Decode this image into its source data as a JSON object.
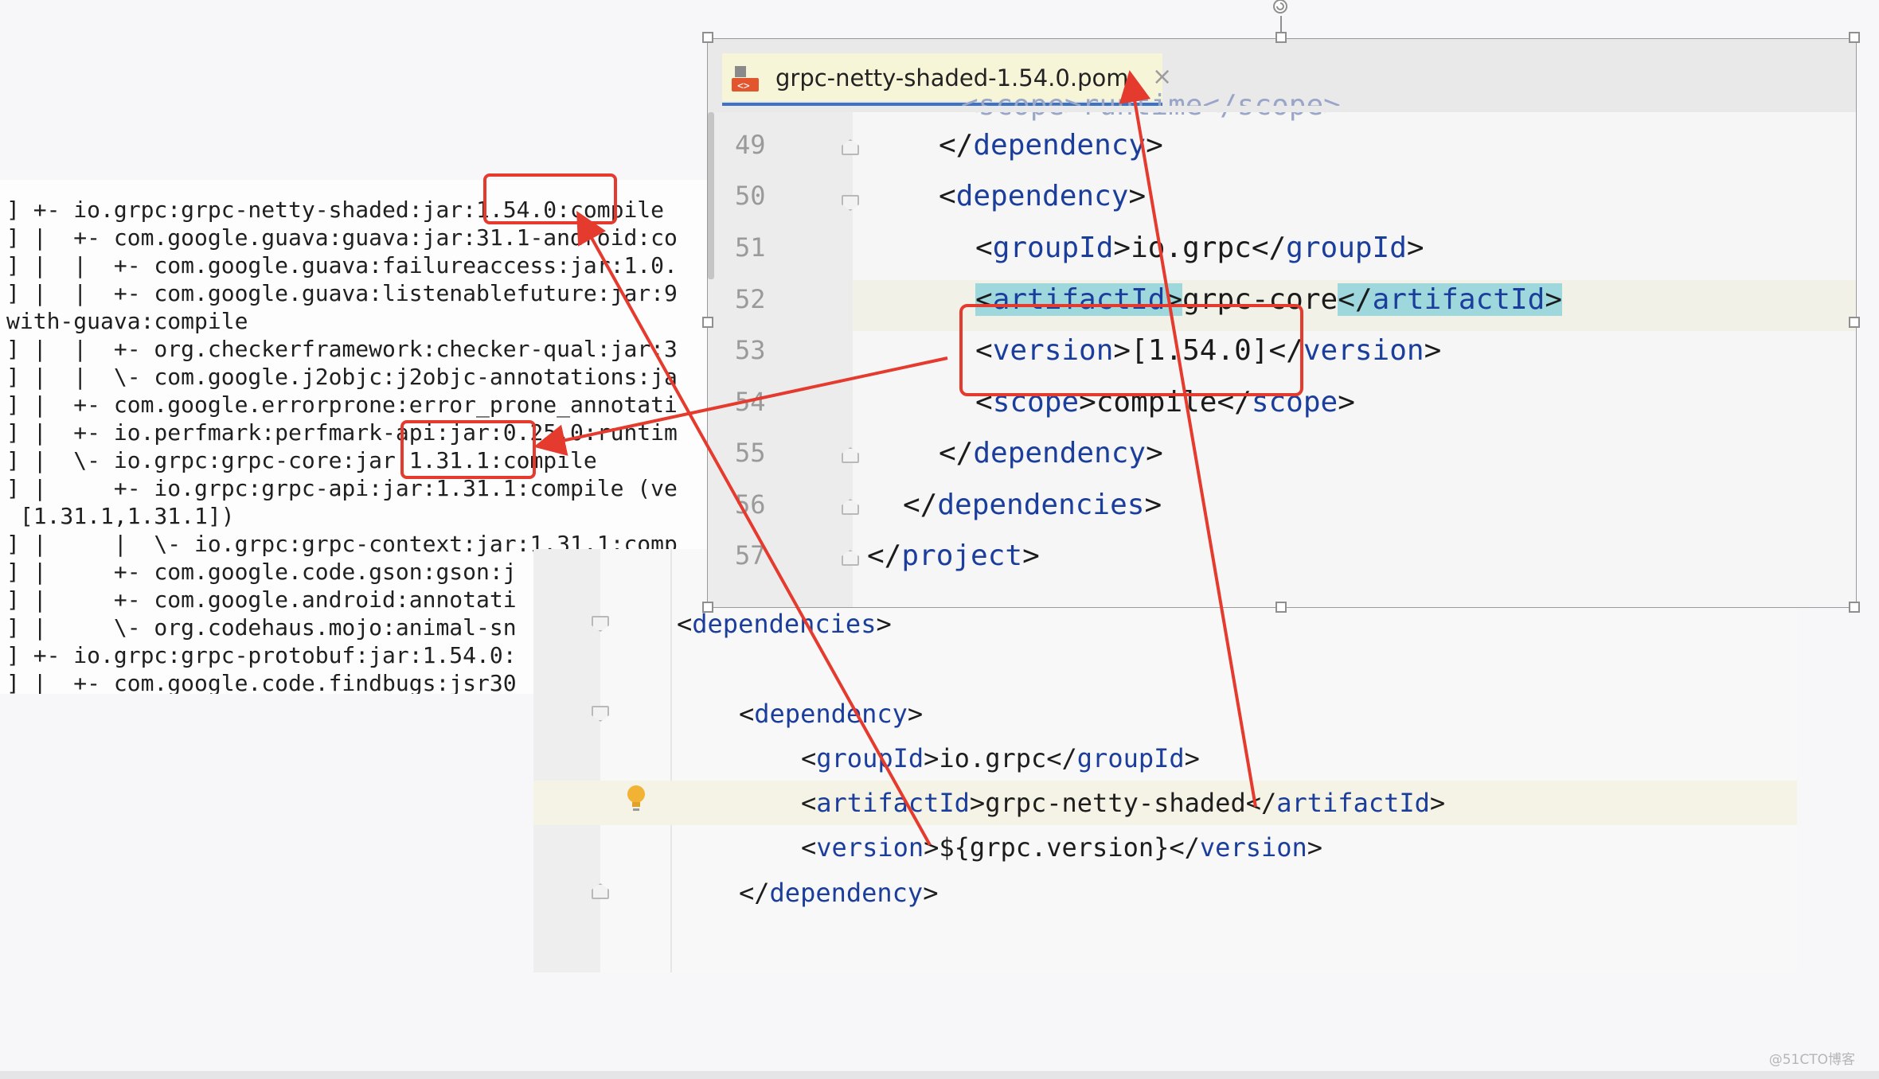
{
  "terminal": {
    "lines": [
      "] +- io.grpc:grpc-netty-shaded:jar:1.54.0:compile",
      "] |  +- com.google.guava:guava:jar:31.1-android:co",
      "] |  |  +- com.google.guava:failureaccess:jar:1.0.",
      "] |  |  +- com.google.guava:listenablefuture:jar:9",
      "with-guava:compile",
      "] |  |  +- org.checkerframework:checker-qual:jar:3",
      "] |  |  \\- com.google.j2objc:j2objc-annotations:ja",
      "] |  +- com.google.errorprone:error_prone_annotati",
      "] |  +- io.perfmark:perfmark-api:jar:0.25.0:runtim",
      "] |  \\- io.grpc:grpc-core:jar:1.31.1:compile",
      "] |     +- io.grpc:grpc-api:jar:1.31.1:compile (ve",
      " [1.31.1,1.31.1])",
      "] |     |  \\- io.grpc:grpc-context:jar:1.31.1:comp",
      "] |     +- com.google.code.gson:gson:j",
      "] |     +- com.google.android:annotati",
      "] |     \\- org.codehaus.mojo:animal-sn",
      "] +- io.grpc:grpc-protobuf:jar:1.54.0:",
      "] |  +- com.google.code.findbugs:jsr30"
    ]
  },
  "upper_editor": {
    "tab_title": "grpc-netty-shaded-1.54.0.pom",
    "tab_close": "×",
    "lines": [
      {
        "num": "49",
        "open": "</",
        "tag": "dependency",
        "close": ">",
        "text": "",
        "end_open": "",
        "end_tag": "",
        "end_close": ""
      },
      {
        "num": "50",
        "open": "<",
        "tag": "dependency",
        "close": ">",
        "text": "",
        "end_open": "",
        "end_tag": "",
        "end_close": ""
      },
      {
        "num": "51",
        "open": "<",
        "tag": "groupId",
        "close": ">",
        "text": "io.grpc",
        "end_open": "</",
        "end_tag": "groupId",
        "end_close": ">"
      },
      {
        "num": "52",
        "open": "<",
        "tag": "artifactId",
        "close": ">",
        "text": "grpc-core",
        "end_open": "</",
        "end_tag": "artifactId",
        "end_close": ">"
      },
      {
        "num": "53",
        "open": "<",
        "tag": "version",
        "close": ">",
        "text": "[1.54.0]",
        "end_open": "</",
        "end_tag": "version",
        "end_close": ">"
      },
      {
        "num": "54",
        "open": "<",
        "tag": "scope",
        "close": ">",
        "text": "compile",
        "end_open": "</",
        "end_tag": "scope",
        "end_close": ">"
      },
      {
        "num": "55",
        "open": "</",
        "tag": "dependency",
        "close": ">",
        "text": "",
        "end_open": "",
        "end_tag": "",
        "end_close": ""
      },
      {
        "num": "56",
        "open": "</",
        "tag": "dependencies",
        "close": ">",
        "text": "",
        "end_open": "",
        "end_tag": "",
        "end_close": ""
      },
      {
        "num": "57",
        "open": "</",
        "tag": "project",
        "close": ">",
        "text": "",
        "end_open": "",
        "end_tag": "",
        "end_close": ""
      }
    ]
  },
  "lower_editor": {
    "lines": [
      {
        "open": "<",
        "tag": "dependencies",
        "close": ">",
        "text": "",
        "end_open": "",
        "end_tag": "",
        "end_close": ""
      },
      {
        "open": "<",
        "tag": "dependency",
        "close": ">",
        "text": "",
        "end_open": "",
        "end_tag": "",
        "end_close": ""
      },
      {
        "open": "<",
        "tag": "groupId",
        "close": ">",
        "text": "io.grpc",
        "end_open": "</",
        "end_tag": "groupId",
        "end_close": ">"
      },
      {
        "open": "<",
        "tag": "artifactId",
        "close": ">",
        "text": "grpc-netty-shaded",
        "end_open": "</",
        "end_tag": "artifactId",
        "end_close": ">"
      },
      {
        "open": "<",
        "tag": "version",
        "close": ">",
        "text": "${grpc.version}",
        "end_open": "</",
        "end_tag": "version",
        "end_close": ">"
      },
      {
        "open": "</",
        "tag": "dependency",
        "close": ">",
        "text": "",
        "end_open": "",
        "end_tag": "",
        "end_close": ""
      }
    ]
  },
  "annotation_color": "#e53a2e",
  "tag_color": "#1b3e9c",
  "watermark": "@51CTO博客"
}
